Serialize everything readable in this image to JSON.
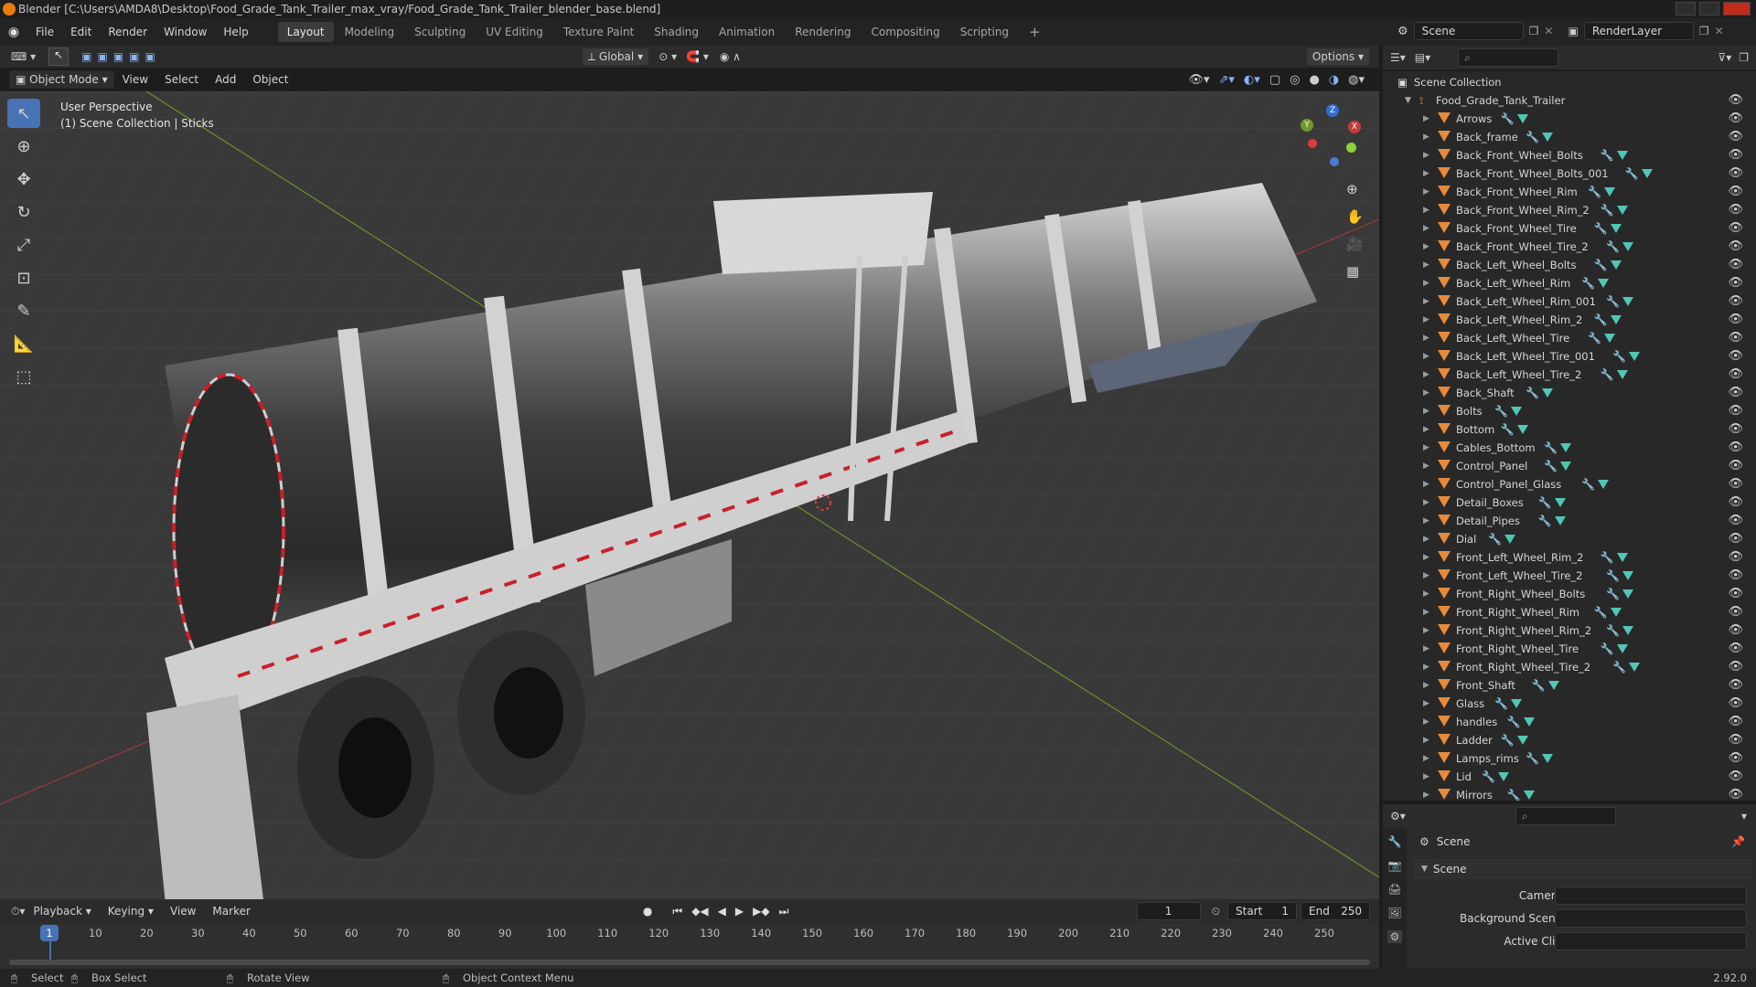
{
  "window": {
    "title": "Blender [C:\\Users\\AMDA8\\Desktop\\Food_Grade_Tank_Trailer_max_vray/Food_Grade_Tank_Trailer_blender_base.blend]"
  },
  "menu": [
    "File",
    "Edit",
    "Render",
    "Window",
    "Help"
  ],
  "workspaces": [
    "Layout",
    "Modeling",
    "Sculpting",
    "UV Editing",
    "Texture Paint",
    "Shading",
    "Animation",
    "Rendering",
    "Compositing",
    "Scripting"
  ],
  "active_workspace": "Layout",
  "scene_selector": "Scene",
  "renderlayer_selector": "RenderLayer",
  "viewport_header": {
    "transform_orientation": "Global",
    "options": "Options",
    "mode": "Object Mode",
    "menus": [
      "View",
      "Select",
      "Add",
      "Object"
    ]
  },
  "viewport": {
    "perspective": "User Perspective",
    "collection_info": "(1) Scene Collection | Sticks",
    "gizmo": {
      "x": "X",
      "y": "Y",
      "z": "Z"
    }
  },
  "outliner": {
    "root": "Scene Collection",
    "collection": "Food_Grade_Tank_Trailer",
    "objects": [
      "Arrows",
      "Back_frame",
      "Back_Front_Wheel_Bolts",
      "Back_Front_Wheel_Bolts_001",
      "Back_Front_Wheel_Rim",
      "Back_Front_Wheel_Rim_2",
      "Back_Front_Wheel_Tire",
      "Back_Front_Wheel_Tire_2",
      "Back_Left_Wheel_Bolts",
      "Back_Left_Wheel_Rim",
      "Back_Left_Wheel_Rim_001",
      "Back_Left_Wheel_Rim_2",
      "Back_Left_Wheel_Tire",
      "Back_Left_Wheel_Tire_001",
      "Back_Left_Wheel_Tire_2",
      "Back_Shaft",
      "Bolts",
      "Bottom",
      "Cables_Bottom",
      "Control_Panel",
      "Control_Panel_Glass",
      "Detail_Boxes",
      "Detail_Pipes",
      "Dial",
      "Front_Left_Wheel_Rim_2",
      "Front_Left_Wheel_Tire_2",
      "Front_Right_Wheel_Bolts",
      "Front_Right_Wheel_Rim",
      "Front_Right_Wheel_Rim_2",
      "Front_Right_Wheel_Tire",
      "Front_Right_Wheel_Tire_2",
      "Front_Shaft",
      "Glass",
      "handles",
      "Ladder",
      "Lamps_rims",
      "Lid",
      "Mirrors"
    ]
  },
  "properties": {
    "context": "Scene",
    "panel": "Scene",
    "fields": [
      {
        "label": "Camera",
        "value": ""
      },
      {
        "label": "Background Scene",
        "value": ""
      },
      {
        "label": "Active Clip",
        "value": ""
      }
    ]
  },
  "timeline": {
    "menus": [
      "Playback",
      "Keying",
      "View",
      "Marker"
    ],
    "current_frame": "1",
    "start_label": "Start",
    "start": "1",
    "end_label": "End",
    "end": "250",
    "ticks": [
      "1",
      "10",
      "20",
      "30",
      "40",
      "50",
      "60",
      "70",
      "80",
      "90",
      "100",
      "110",
      "120",
      "130",
      "140",
      "150",
      "160",
      "170",
      "180",
      "190",
      "200",
      "210",
      "220",
      "230",
      "240",
      "250"
    ]
  },
  "statusbar": {
    "items": [
      "Select",
      "Box Select",
      "Rotate View",
      "Object Context Menu"
    ],
    "version": "2.92.0"
  },
  "colors": {
    "accent": "#4772b3",
    "object_icon": "#e78b3b",
    "mesh_icon": "#4fc7b4",
    "frame_marker": "#4772b3"
  }
}
